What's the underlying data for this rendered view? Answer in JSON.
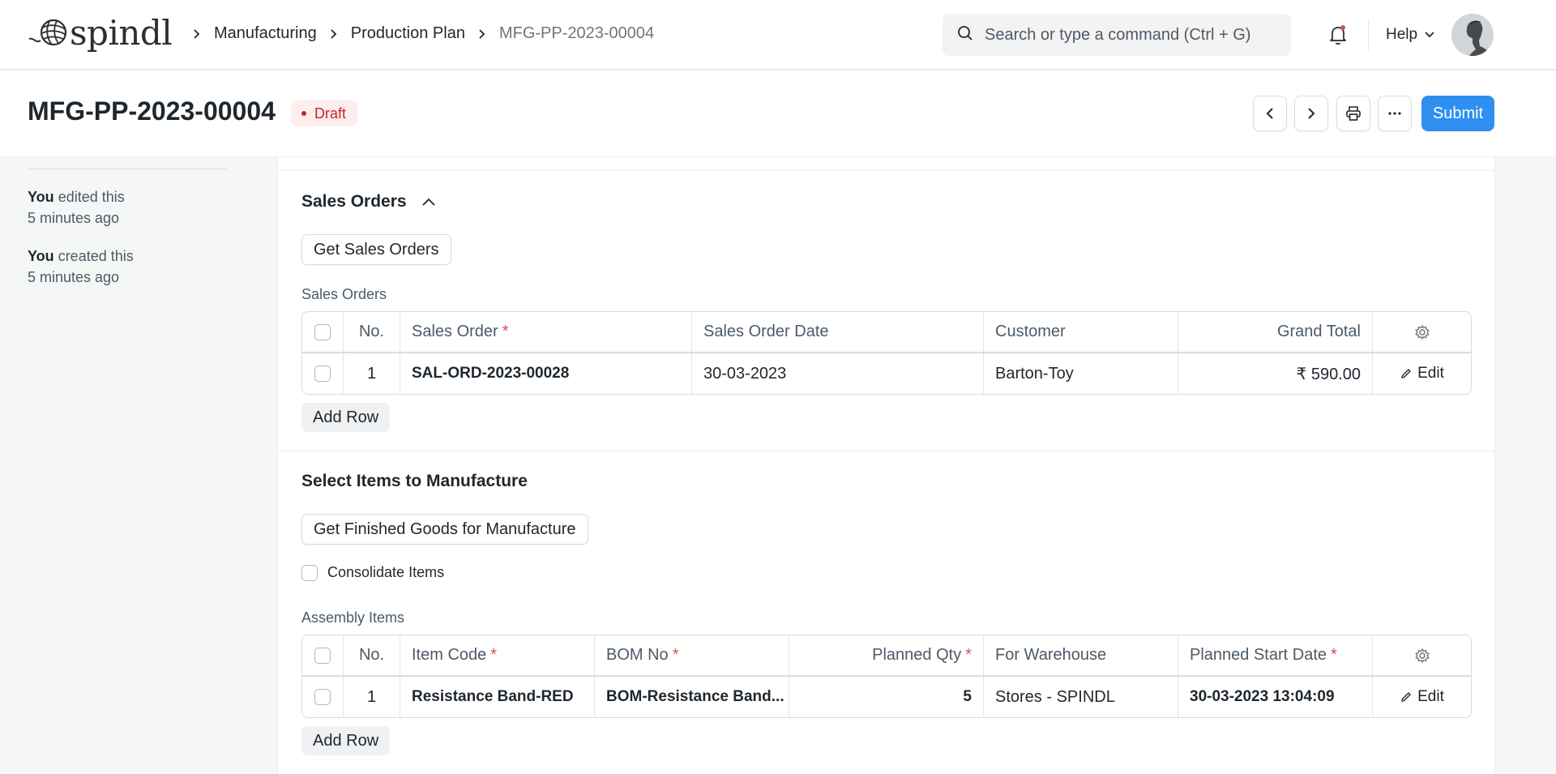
{
  "navbar": {
    "logo_text": "spindl",
    "breadcrumbs": [
      "Manufacturing",
      "Production Plan",
      "MFG-PP-2023-00004"
    ],
    "search_placeholder": "Search or type a command (Ctrl + G)",
    "help_label": "Help"
  },
  "page": {
    "title": "MFG-PP-2023-00004",
    "status": "Draft",
    "submit_label": "Submit"
  },
  "sidebar": {
    "activity": [
      {
        "who": "You",
        "action": "edited this",
        "when": "5 minutes ago"
      },
      {
        "who": "You",
        "action": "created this",
        "when": "5 minutes ago"
      }
    ]
  },
  "sales_orders_section": {
    "title": "Sales Orders",
    "get_button": "Get Sales Orders",
    "table_label": "Sales Orders",
    "columns": [
      "No.",
      "Sales Order",
      "Sales Order Date",
      "Customer",
      "Grand Total"
    ],
    "rows": [
      {
        "no": "1",
        "sales_order": "SAL-ORD-2023-00028",
        "date": "30-03-2023",
        "customer": "Barton-Toy",
        "grand_total": "₹ 590.00",
        "edit": "Edit"
      }
    ],
    "add_row": "Add Row"
  },
  "items_section": {
    "title": "Select Items to Manufacture",
    "get_button": "Get Finished Goods for Manufacture",
    "consolidate_label": "Consolidate Items",
    "table_label": "Assembly Items",
    "columns": [
      "No.",
      "Item Code",
      "BOM No",
      "Planned Qty",
      "For Warehouse",
      "Planned Start Date"
    ],
    "rows": [
      {
        "no": "1",
        "item_code": "Resistance Band-RED",
        "bom_no": "BOM-Resistance Band...",
        "planned_qty": "5",
        "warehouse": "Stores - SPINDL",
        "start_date": "30-03-2023 13:04:09",
        "edit": "Edit"
      }
    ],
    "add_row": "Add Row"
  },
  "colors": {
    "primary": "#2f8ff0",
    "draft_bg": "#fdeded",
    "draft_text": "#c72727",
    "required": "#e24c4c"
  },
  "icons": [
    "yarn-logo-icon",
    "chevron-right-icon",
    "search-icon",
    "bell-icon",
    "chevron-down-icon",
    "chevron-left-icon",
    "printer-icon",
    "more-icon",
    "chevron-up-icon",
    "gear-icon",
    "pencil-icon"
  ]
}
